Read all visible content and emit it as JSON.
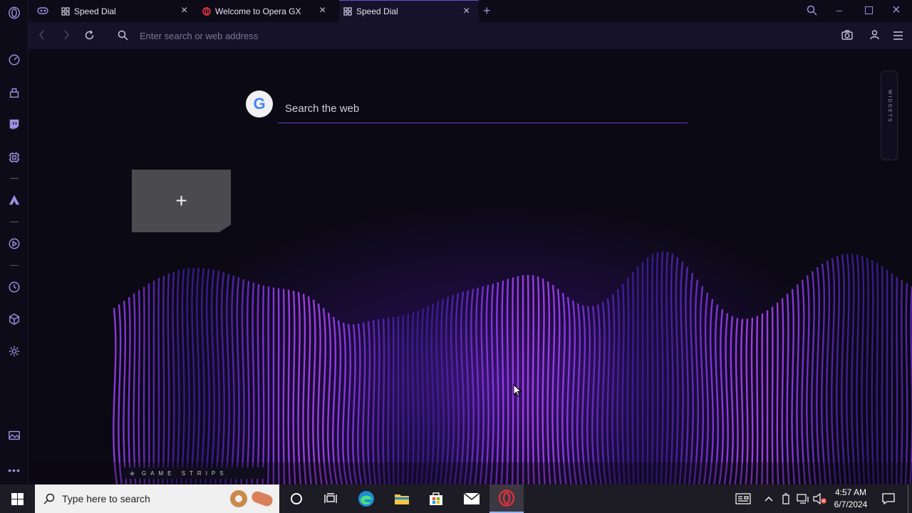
{
  "tabs": [
    {
      "title": "Speed Dial",
      "icon": "speed-dial-icon"
    },
    {
      "title": "Welcome to Opera GX",
      "icon": "opera-gx-icon"
    },
    {
      "title": "Speed Dial",
      "icon": "speed-dial-icon",
      "active": true
    }
  ],
  "address_bar": {
    "placeholder": "Enter search or web address"
  },
  "speed_dial": {
    "search_placeholder": "Search the web",
    "google_letter": "G",
    "add_tile_label": "+",
    "widgets_label": "WIDGETS",
    "game_strips_label": "GAME STRIPS"
  },
  "taskbar": {
    "search_placeholder": "Type here to search",
    "time": "4:57 AM",
    "date": "6/7/2024"
  },
  "colors": {
    "accent": "#6f4bd8",
    "sidebar_icon": "#9d8fe0",
    "wave": "#8a4fe0"
  }
}
